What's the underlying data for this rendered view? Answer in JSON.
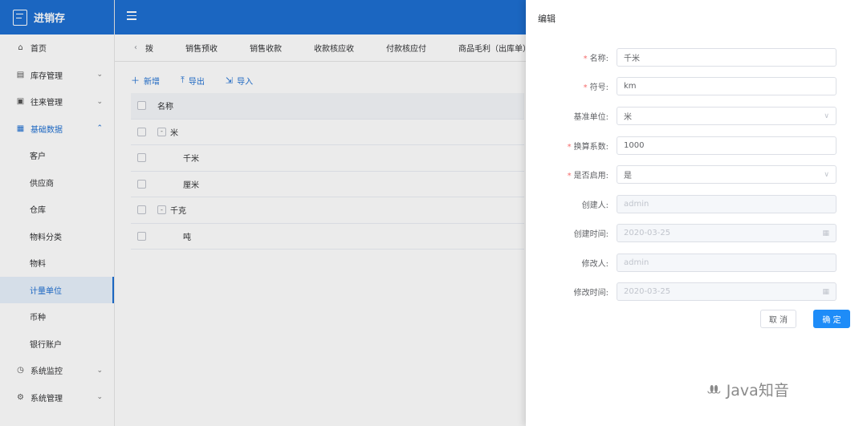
{
  "app": {
    "logo_title": "进销存"
  },
  "sidebar": {
    "items": [
      {
        "label": "首页",
        "icon": "home-icon",
        "glyph": "⌂"
      },
      {
        "label": "库存管理",
        "icon": "inventory-icon",
        "glyph": "▤",
        "chevron": "⌄"
      },
      {
        "label": "往来管理",
        "icon": "contacts-icon",
        "glyph": "▣",
        "chevron": "⌄"
      },
      {
        "label": "基础数据",
        "icon": "grid-icon",
        "glyph": "▦",
        "chevron": "⌃"
      }
    ],
    "sub_items": [
      "客户",
      "供应商",
      "仓库",
      "物料分类",
      "物料",
      "计量单位",
      "币种",
      "银行账户"
    ],
    "bottom_items": [
      {
        "label": "系统监控",
        "icon": "monitor-icon",
        "glyph": "◷",
        "chevron": "⌄"
      },
      {
        "label": "系统管理",
        "icon": "settings-icon",
        "glyph": "⚙",
        "chevron": "⌄"
      }
    ]
  },
  "tabs": {
    "prev": "‹",
    "first": "拨",
    "items": [
      "销售预收",
      "销售收款",
      "收款核应收",
      "付款核应付",
      "商品毛利（出库单）"
    ]
  },
  "toolbar": {
    "add": "新增",
    "export": "导出",
    "import": "导入"
  },
  "table": {
    "header": "名称",
    "rows": [
      {
        "name": "米",
        "toggle": "-",
        "level": 0
      },
      {
        "name": "千米",
        "level": 1
      },
      {
        "name": "厘米",
        "level": 1
      },
      {
        "name": "千克",
        "toggle": "-",
        "level": 0
      },
      {
        "name": "吨",
        "level": 1
      }
    ]
  },
  "drawer": {
    "title": "编辑",
    "fields": {
      "name": {
        "label": "名称:",
        "value": "千米",
        "required": true
      },
      "symbol": {
        "label": "符号:",
        "value": "km",
        "required": true
      },
      "base_unit": {
        "label": "基准单位:",
        "value": "米",
        "required": false
      },
      "factor": {
        "label": "换算系数:",
        "value": "1000",
        "required": true
      },
      "enabled": {
        "label": "是否启用:",
        "value": "是",
        "required": true
      },
      "creator": {
        "label": "创建人:",
        "value": "admin"
      },
      "created_at": {
        "label": "创建时间:",
        "value": "2020-03-25"
      },
      "modifier": {
        "label": "修改人:",
        "value": "admin"
      },
      "modified_at": {
        "label": "修改时间:",
        "value": "2020-03-25"
      }
    },
    "cancel": "取 消",
    "confirm": "确 定"
  },
  "watermark": "Java知音",
  "colors": {
    "primary": "#1e6fd2",
    "confirm": "#1e8cf8",
    "required": "#f56c6c"
  }
}
